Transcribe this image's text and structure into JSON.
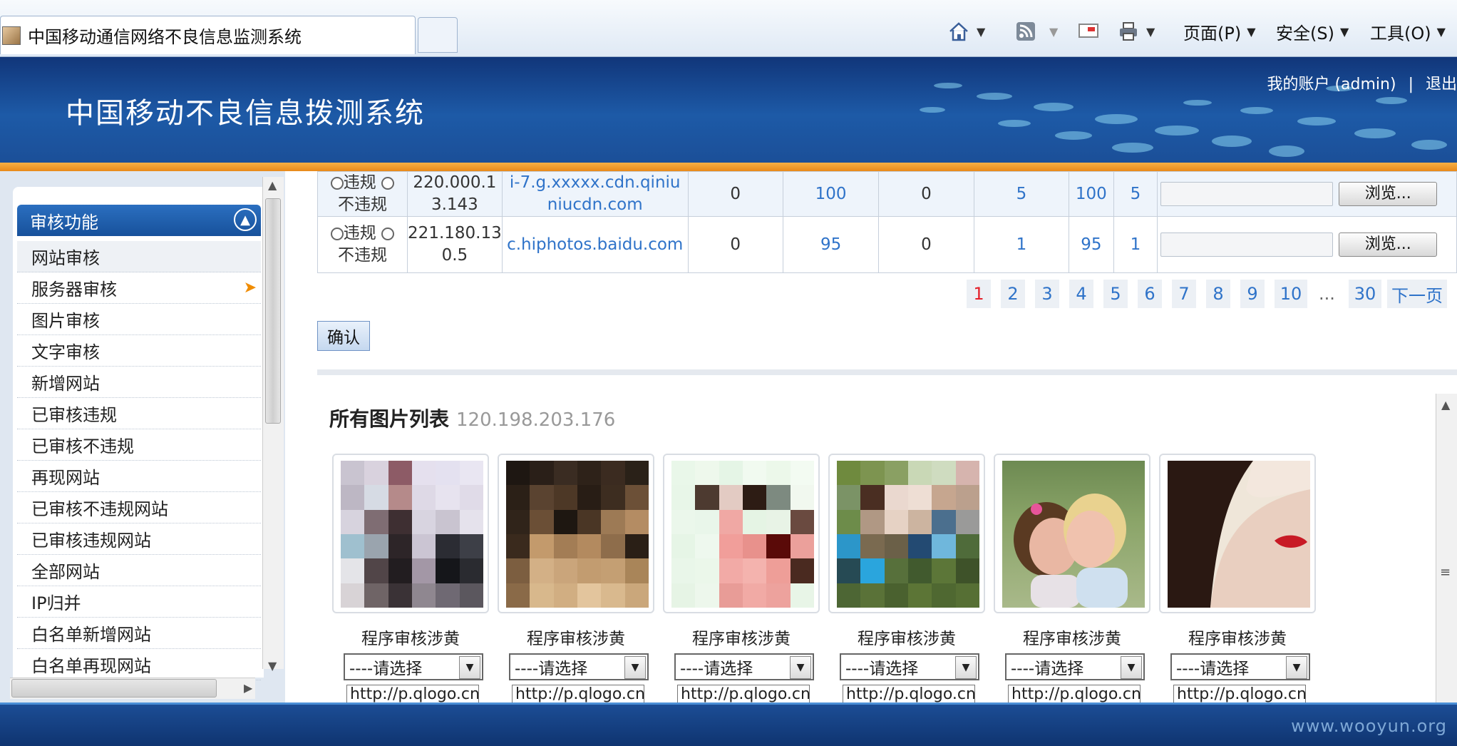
{
  "browser": {
    "tab_title": "中国移动通信网络不良信息监测系统",
    "menus": {
      "page": "页面(P)",
      "safety": "安全(S)",
      "tools": "工具(O)"
    },
    "icons": [
      "home-icon",
      "rss-icon",
      "mail-icon",
      "print-icon"
    ]
  },
  "header": {
    "title": "中国移动不良信息拨测系统",
    "account": "我的账户 (admin)",
    "separator": "|",
    "logout": "退出"
  },
  "sidebar": {
    "section_title": "审核功能",
    "items": [
      {
        "label": "网站审核"
      },
      {
        "label": "服务器审核"
      },
      {
        "label": "图片审核"
      },
      {
        "label": "文字审核"
      },
      {
        "label": "新增网站"
      },
      {
        "label": "已审核违规"
      },
      {
        "label": "已审核不违规"
      },
      {
        "label": "再现网站"
      },
      {
        "label": "已审核不违规网站"
      },
      {
        "label": "已审核违规网站"
      },
      {
        "label": "全部网站"
      },
      {
        "label": "IP归并"
      },
      {
        "label": "白名单新增网站"
      },
      {
        "label": "白名单再现网站"
      }
    ]
  },
  "table": {
    "rows": [
      {
        "opt_violation": "违规",
        "opt_ok": "不违规",
        "ip_top": "220.000.1",
        "ip_bottom": "3.143",
        "domain_top": "i-7.g.xxxxx.cdn.qiniu",
        "domain_bottom": "niucdn.com",
        "c1": "0",
        "c2": "100",
        "c3": "0",
        "c4": "5",
        "c5": "100",
        "c6": "5",
        "browse": "浏览..."
      },
      {
        "opt_violation": "违规",
        "opt_ok": "不违规",
        "ip_top": "221.180.13",
        "ip_bottom": "0.5",
        "domain_top": "c.hiphotos.baidu.com",
        "domain_bottom": "",
        "c1": "0",
        "c2": "95",
        "c3": "0",
        "c4": "1",
        "c5": "95",
        "c6": "1",
        "browse": "浏览..."
      }
    ]
  },
  "pagination": {
    "pages": [
      "1",
      "2",
      "3",
      "4",
      "5",
      "6",
      "7",
      "8",
      "9",
      "10"
    ],
    "ellipsis": "...",
    "last": "30",
    "next": "下一页",
    "current": "1"
  },
  "confirm_label": "确认",
  "images": {
    "title": "所有图片列表",
    "ip": "120.198.203.176",
    "cards": [
      {
        "caption": "程序审核涉黄",
        "select": "----请选择",
        "url": "http://p.qlogo.cn"
      },
      {
        "caption": "程序审核涉黄",
        "select": "----请选择",
        "url": "http://p.qlogo.cn"
      },
      {
        "caption": "程序审核涉黄",
        "select": "----请选择",
        "url": "http://p.qlogo.cn"
      },
      {
        "caption": "程序审核涉黄",
        "select": "----请选择",
        "url": "http://p.qlogo.cn"
      },
      {
        "caption": "程序审核涉黄",
        "select": "----请选择",
        "url": "http://p.qlogo.cn"
      },
      {
        "caption": "程序审核涉黄",
        "select": "----请选择",
        "url": "http://p.qlogo.cn"
      }
    ]
  },
  "watermark": "www.wooyun.org"
}
